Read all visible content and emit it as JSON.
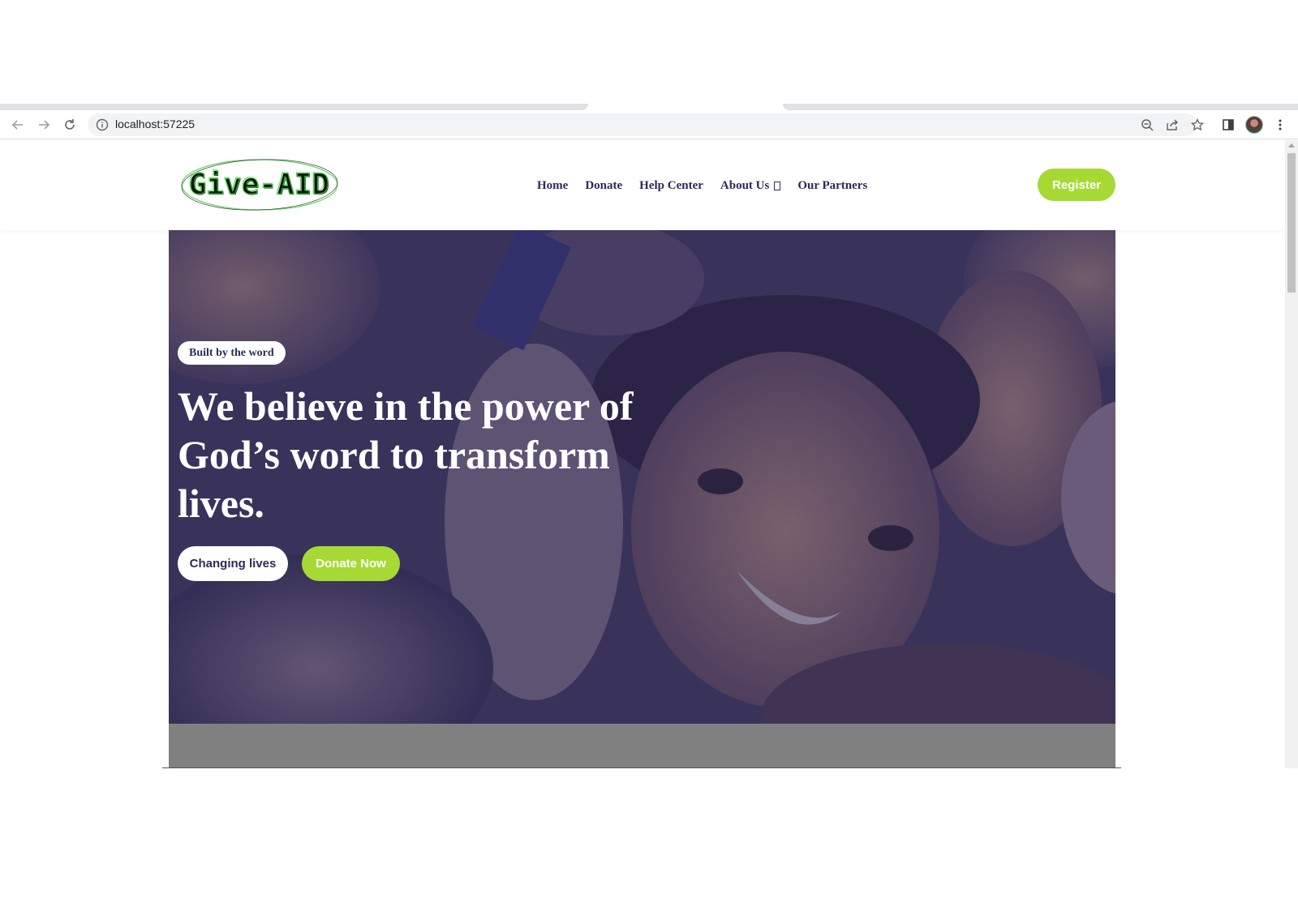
{
  "browser": {
    "url": "localhost:57225"
  },
  "site": {
    "logo_text": "Give-AID",
    "nav": [
      {
        "label": "Home"
      },
      {
        "label": "Donate"
      },
      {
        "label": "Help Center"
      },
      {
        "label": "About Us"
      },
      {
        "label": "Our Partners"
      }
    ],
    "register_label": "Register"
  },
  "hero": {
    "badge": "Built by the word",
    "headline": "We believe in the power of God’s word to transform lives.",
    "primary_button": "Changing lives",
    "secondary_button": "Donate Now"
  },
  "colors": {
    "accent_green": "#a6d934",
    "brand_navy": "#2d2a5a",
    "overlay": "#2c2854"
  },
  "icons": [
    "back-arrow-icon",
    "forward-arrow-icon",
    "reload-icon",
    "info-icon",
    "zoom-out-icon",
    "share-icon",
    "star-icon",
    "side-panel-icon",
    "profile-avatar",
    "kebab-menu-icon",
    "dropdown-caret-icon"
  ]
}
